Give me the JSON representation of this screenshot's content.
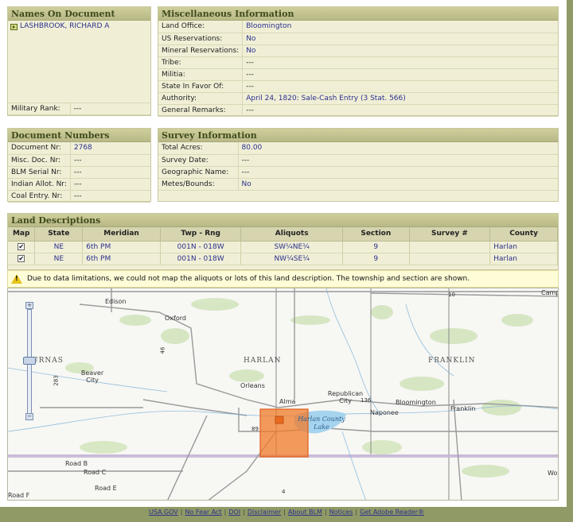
{
  "names": {
    "title": "Names On Document",
    "name": "LASHBROOK, RICHARD A",
    "military_rank_label": "Military Rank:",
    "military_rank_value": "---"
  },
  "misc": {
    "title": "Miscellaneous Information",
    "rows": [
      {
        "label": "Land Office:",
        "value": "Bloomington"
      },
      {
        "label": "US Reservations:",
        "value": "No"
      },
      {
        "label": "Mineral Reservations:",
        "value": "No"
      },
      {
        "label": "Tribe:",
        "value": "---"
      },
      {
        "label": "Militia:",
        "value": "---"
      },
      {
        "label": "State In Favor Of:",
        "value": "---"
      },
      {
        "label": "Authority:",
        "value": "April 24, 1820: Sale-Cash Entry (3 Stat. 566)"
      },
      {
        "label": "General Remarks:",
        "value": "---"
      }
    ]
  },
  "docnums": {
    "title": "Document Numbers",
    "rows": [
      {
        "label": "Document Nr:",
        "value": "2768"
      },
      {
        "label": "Misc. Doc. Nr:",
        "value": "---"
      },
      {
        "label": "BLM Serial Nr:",
        "value": "---"
      },
      {
        "label": "Indian Allot. Nr:",
        "value": "---"
      },
      {
        "label": "Coal Entry. Nr:",
        "value": "---"
      }
    ]
  },
  "survey": {
    "title": "Survey Information",
    "rows": [
      {
        "label": "Total Acres:",
        "value": "80.00"
      },
      {
        "label": "Survey Date:",
        "value": "---"
      },
      {
        "label": "Geographic Name:",
        "value": "---"
      },
      {
        "label": "Metes/Bounds:",
        "value": "No"
      }
    ]
  },
  "land": {
    "title": "Land Descriptions",
    "headers": [
      "Map",
      "State",
      "Meridian",
      "Twp - Rng",
      "Aliquots",
      "Section",
      "Survey #",
      "County"
    ],
    "rows": [
      {
        "map": "✔",
        "state": "NE",
        "meridian": "6th PM",
        "twp": "001N - 018W",
        "aliquots": "SW¼NE¼",
        "section": "9",
        "survey": "",
        "county": "Harlan"
      },
      {
        "map": "✔",
        "state": "NE",
        "meridian": "6th PM",
        "twp": "001N - 018W",
        "aliquots": "NW¼SE¼",
        "section": "9",
        "survey": "",
        "county": "Harlan"
      }
    ],
    "warning": "Due to data limitations, we could not map the aliquots or lots of this land description. The township and section are shown."
  },
  "map": {
    "places": {
      "edison": "Edison",
      "oxford": "Oxford",
      "beaver_city": "Beaver City",
      "orleans": "Orleans",
      "alma": "Alma",
      "republican_city": "Republican City",
      "bloomington": "Bloomington",
      "naponee": "Naponee",
      "franklin": "Franklin",
      "harlan_lake": "Harlan County Lake",
      "road_b": "Road B",
      "road_c": "Road C",
      "road_e": "Road E",
      "road_f": "Road F",
      "camp": "Camp",
      "wo": "Wo"
    },
    "counties": {
      "furnas": "URNAS",
      "harlan": "HARLAN",
      "franklin": "FRANKLIN"
    },
    "shields": {
      "s46": "46",
      "s283": "283",
      "s136": "136",
      "s89": "89",
      "s10": "10",
      "s4": "4"
    },
    "zoom_in": "+",
    "zoom_out": "−",
    "colors": {
      "highlight": "#f07a2a",
      "lake": "#a6d4ef"
    }
  },
  "footer": {
    "links": [
      "USA.GOV",
      "No Fear Act",
      "DOI",
      "Disclaimer",
      "About BLM",
      "Notices",
      "Get Adobe Reader®"
    ]
  }
}
